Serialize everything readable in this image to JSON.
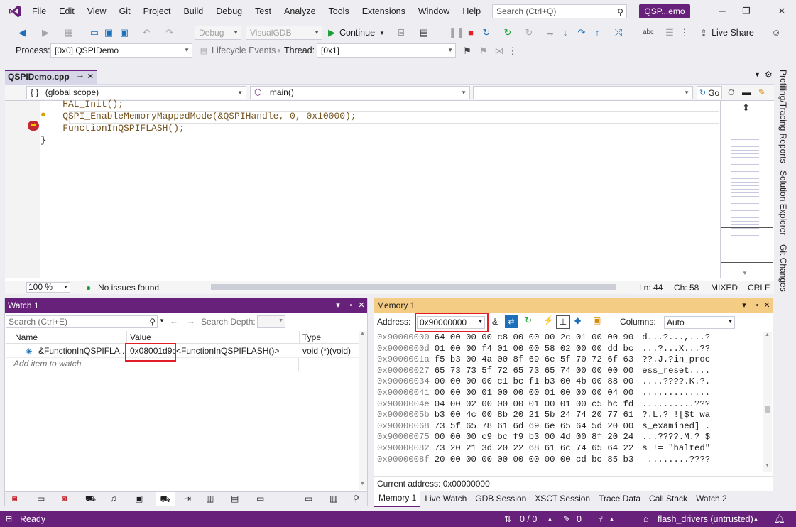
{
  "app": {
    "menu": [
      "File",
      "Edit",
      "View",
      "Git",
      "Project",
      "Build",
      "Debug",
      "Test",
      "Analyze",
      "Tools",
      "Extensions",
      "Window",
      "Help"
    ],
    "search_placeholder": "Search (Ctrl+Q)",
    "window_title": "QSP...emo",
    "accent": "#68217a"
  },
  "toolbar": {
    "config": "Debug",
    "platform": "VisualGDB",
    "continue_label": "Continue",
    "live_share": "Live Share",
    "process_label": "Process:",
    "process_value": "[0x0] QSPIDemo",
    "lifecycle": "Lifecycle Events",
    "thread_label": "Thread:",
    "thread_value": "[0x1]"
  },
  "editor": {
    "tab": "QSPIDemo.cpp",
    "scope": "(global scope)",
    "scope_prefix": "{ }",
    "function": "main()",
    "go_label": "Go",
    "lines": [
      "    HAL_Init();",
      "    QSPI_EnableMemoryMappedMode(&QSPIHandle, 0, 0x10000);",
      "    FunctionInQSPIFLASH();",
      "}"
    ],
    "zoom": "100 %",
    "issues": "No issues found",
    "ln": "Ln: 44",
    "ch": "Ch: 58",
    "eol_mode": "MIXED",
    "eol": "CRLF"
  },
  "side_tabs": [
    "Profiling/Tracing Reports",
    "Solution Explorer",
    "Git Changes"
  ],
  "watch": {
    "title": "Watch 1",
    "search_placeholder": "Search (Ctrl+E)",
    "search_depth_label": "Search Depth:",
    "columns": [
      "Name",
      "Value",
      "Type"
    ],
    "rows": [
      {
        "name": "&FunctionInQSPIFLA...",
        "value": "0x08001d9c",
        "value_suffix": "<FunctionInQSPIFLASH()>",
        "type": "void (*)(void)"
      }
    ],
    "add_item": "Add item to watch"
  },
  "memory": {
    "title": "Memory 1",
    "address_label": "Address:",
    "address_value": "0x90000000",
    "amp": "&",
    "columns_label": "Columns:",
    "columns_value": "Auto",
    "current_address": "Current address: 0x00000000",
    "lines": [
      {
        "addr": "0x90000000",
        "hex": "64 00 00 00 c8 00 00 00 2c 01 00 00 90",
        "ascii": "d...?...,...?"
      },
      {
        "addr": "0x9000000d",
        "hex": "01 00 00 f4 01 00 00 58 02 00 00 dd bc",
        "ascii": "...?...X...??"
      },
      {
        "addr": "0x9000001a",
        "hex": "f5 b3 00 4a 00 8f 69 6e 5f 70 72 6f 63",
        "ascii": "??.J.?in_proc"
      },
      {
        "addr": "0x90000027",
        "hex": "65 73 73 5f 72 65 73 65 74 00 00 00 00",
        "ascii": "ess_reset...."
      },
      {
        "addr": "0x90000034",
        "hex": "00 00 00 00 c1 bc f1 b3 00 4b 00 88 00",
        "ascii": "....????.K.?."
      },
      {
        "addr": "0x90000041",
        "hex": "00 00 00 01 00 00 00 01 00 00 00 04 00",
        "ascii": "............."
      },
      {
        "addr": "0x9000004e",
        "hex": "04 00 02 00 00 00 01 00 01 00 c5 bc fd",
        "ascii": "..........???"
      },
      {
        "addr": "0x9000005b",
        "hex": "b3 00 4c 00 8b 20 21 5b 24 74 20 77 61",
        "ascii": "?.L.? ![$t wa"
      },
      {
        "addr": "0x90000068",
        "hex": "73 5f 65 78 61 6d 69 6e 65 64 5d 20 00",
        "ascii": "s_examined] ."
      },
      {
        "addr": "0x90000075",
        "hex": "00 00 00 c9 bc f9 b3 00 4d 00 8f 20 24",
        "ascii": "...????.M.? $"
      },
      {
        "addr": "0x90000082",
        "hex": "73 20 21 3d 20 22 68 61 6c 74 65 64 22",
        "ascii": "s != \"halted\""
      },
      {
        "addr": "0x9000008f",
        "hex": "20 00 00 00 00 00 00 00 00 cd bc 85 b3",
        "ascii": " ........????"
      }
    ]
  },
  "bottom_tabs": [
    "Memory 1",
    "Live Watch",
    "GDB Session",
    "XSCT Session",
    "Trace Data",
    "Call Stack",
    "Watch 2"
  ],
  "status": {
    "ready": "Ready",
    "updown": "0 / 0",
    "pencil": "0",
    "branch": "flash_drivers (untrusted)"
  }
}
